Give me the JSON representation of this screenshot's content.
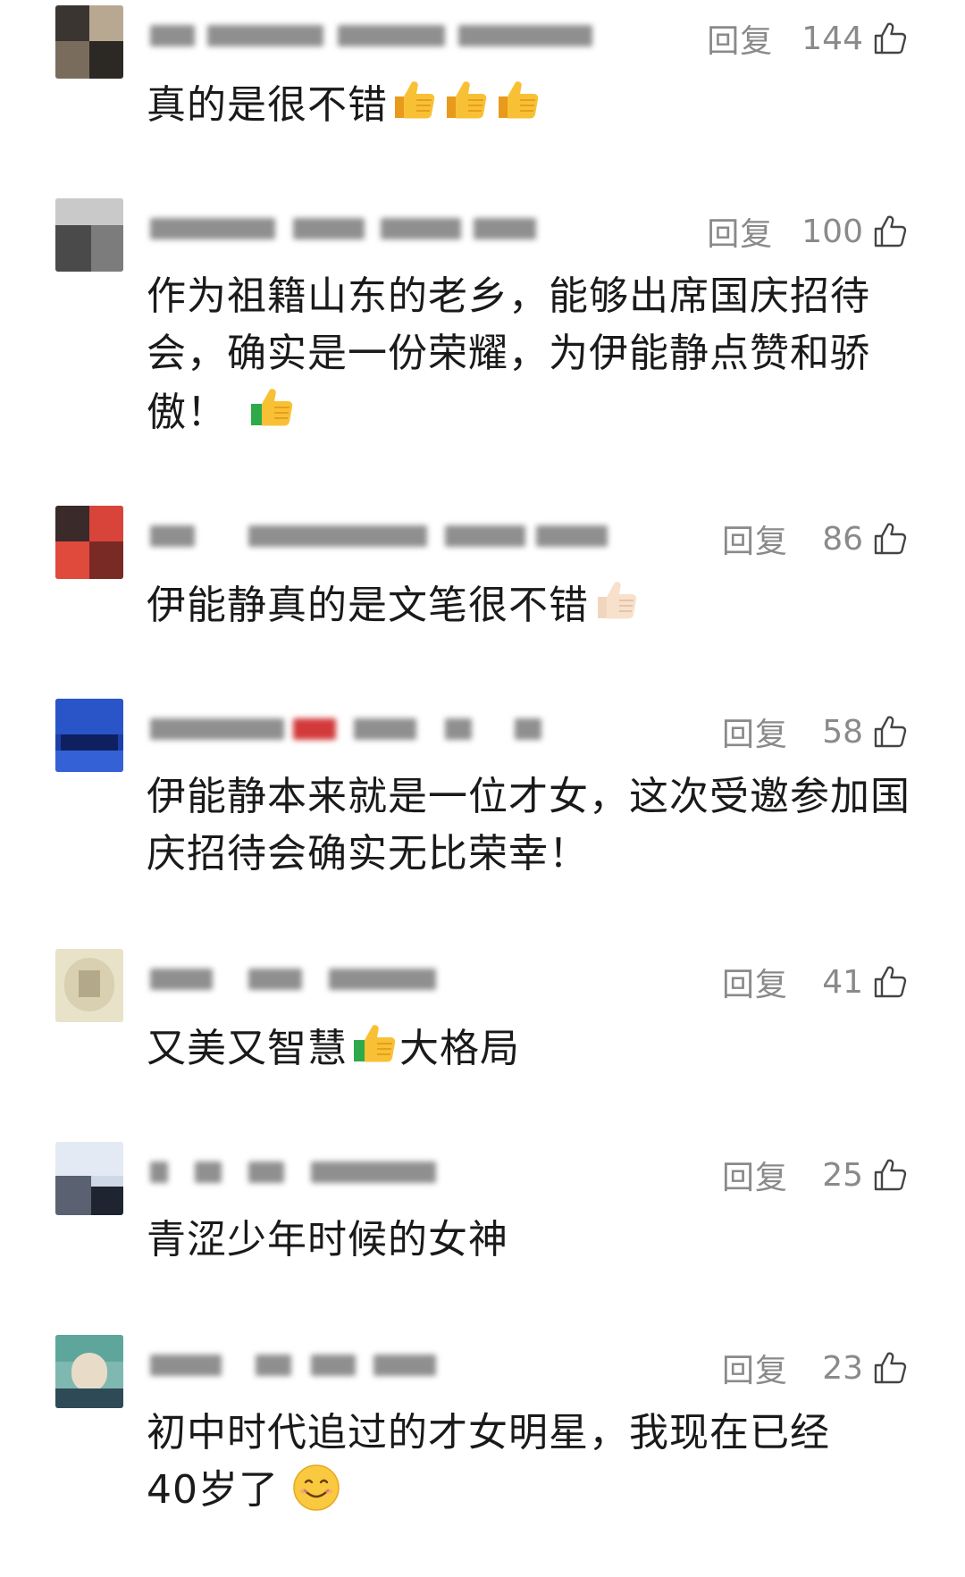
{
  "ui": {
    "reply_label": "回复",
    "like_icon": "thumbs-up-outline-icon"
  },
  "comments": [
    {
      "likes": "144",
      "text": "真的是很不错",
      "emojis": [
        "thumbs-up-emoji",
        "thumbs-up-emoji",
        "thumbs-up-emoji"
      ]
    },
    {
      "likes": "100",
      "text": "作为祖籍山东的老乡，能够出席国庆招待会，确实是一份荣耀，为伊能静点赞和骄傲！",
      "emojis": [
        "thumbs-up-green-cuff-emoji"
      ]
    },
    {
      "likes": "86",
      "text": "伊能静真的是文笔很不错",
      "emojis": [
        "thumbs-up-light-skin-emoji"
      ]
    },
    {
      "likes": "58",
      "text": "伊能静本来就是一位才女，这次受邀参加国庆招待会确实无比荣幸！",
      "emojis": []
    },
    {
      "likes": "41",
      "text_before": "又美又智慧",
      "text_after": "大格局",
      "emojis": [
        "thumbs-up-green-cuff-emoji"
      ]
    },
    {
      "likes": "25",
      "text": "青涩少年时候的女神",
      "emojis": []
    },
    {
      "likes": "23",
      "text_line1": "初中时代追过的才女明星，我现在已经",
      "text_line2": "40岁了",
      "emojis": [
        "smiling-face-emoji"
      ]
    }
  ],
  "colors": {
    "meta_gray": "#8a8a8a",
    "text_dark": "#1a1a1a",
    "emoji_yellow": "#f5b82e",
    "emoji_green": "#2eaa4a"
  }
}
